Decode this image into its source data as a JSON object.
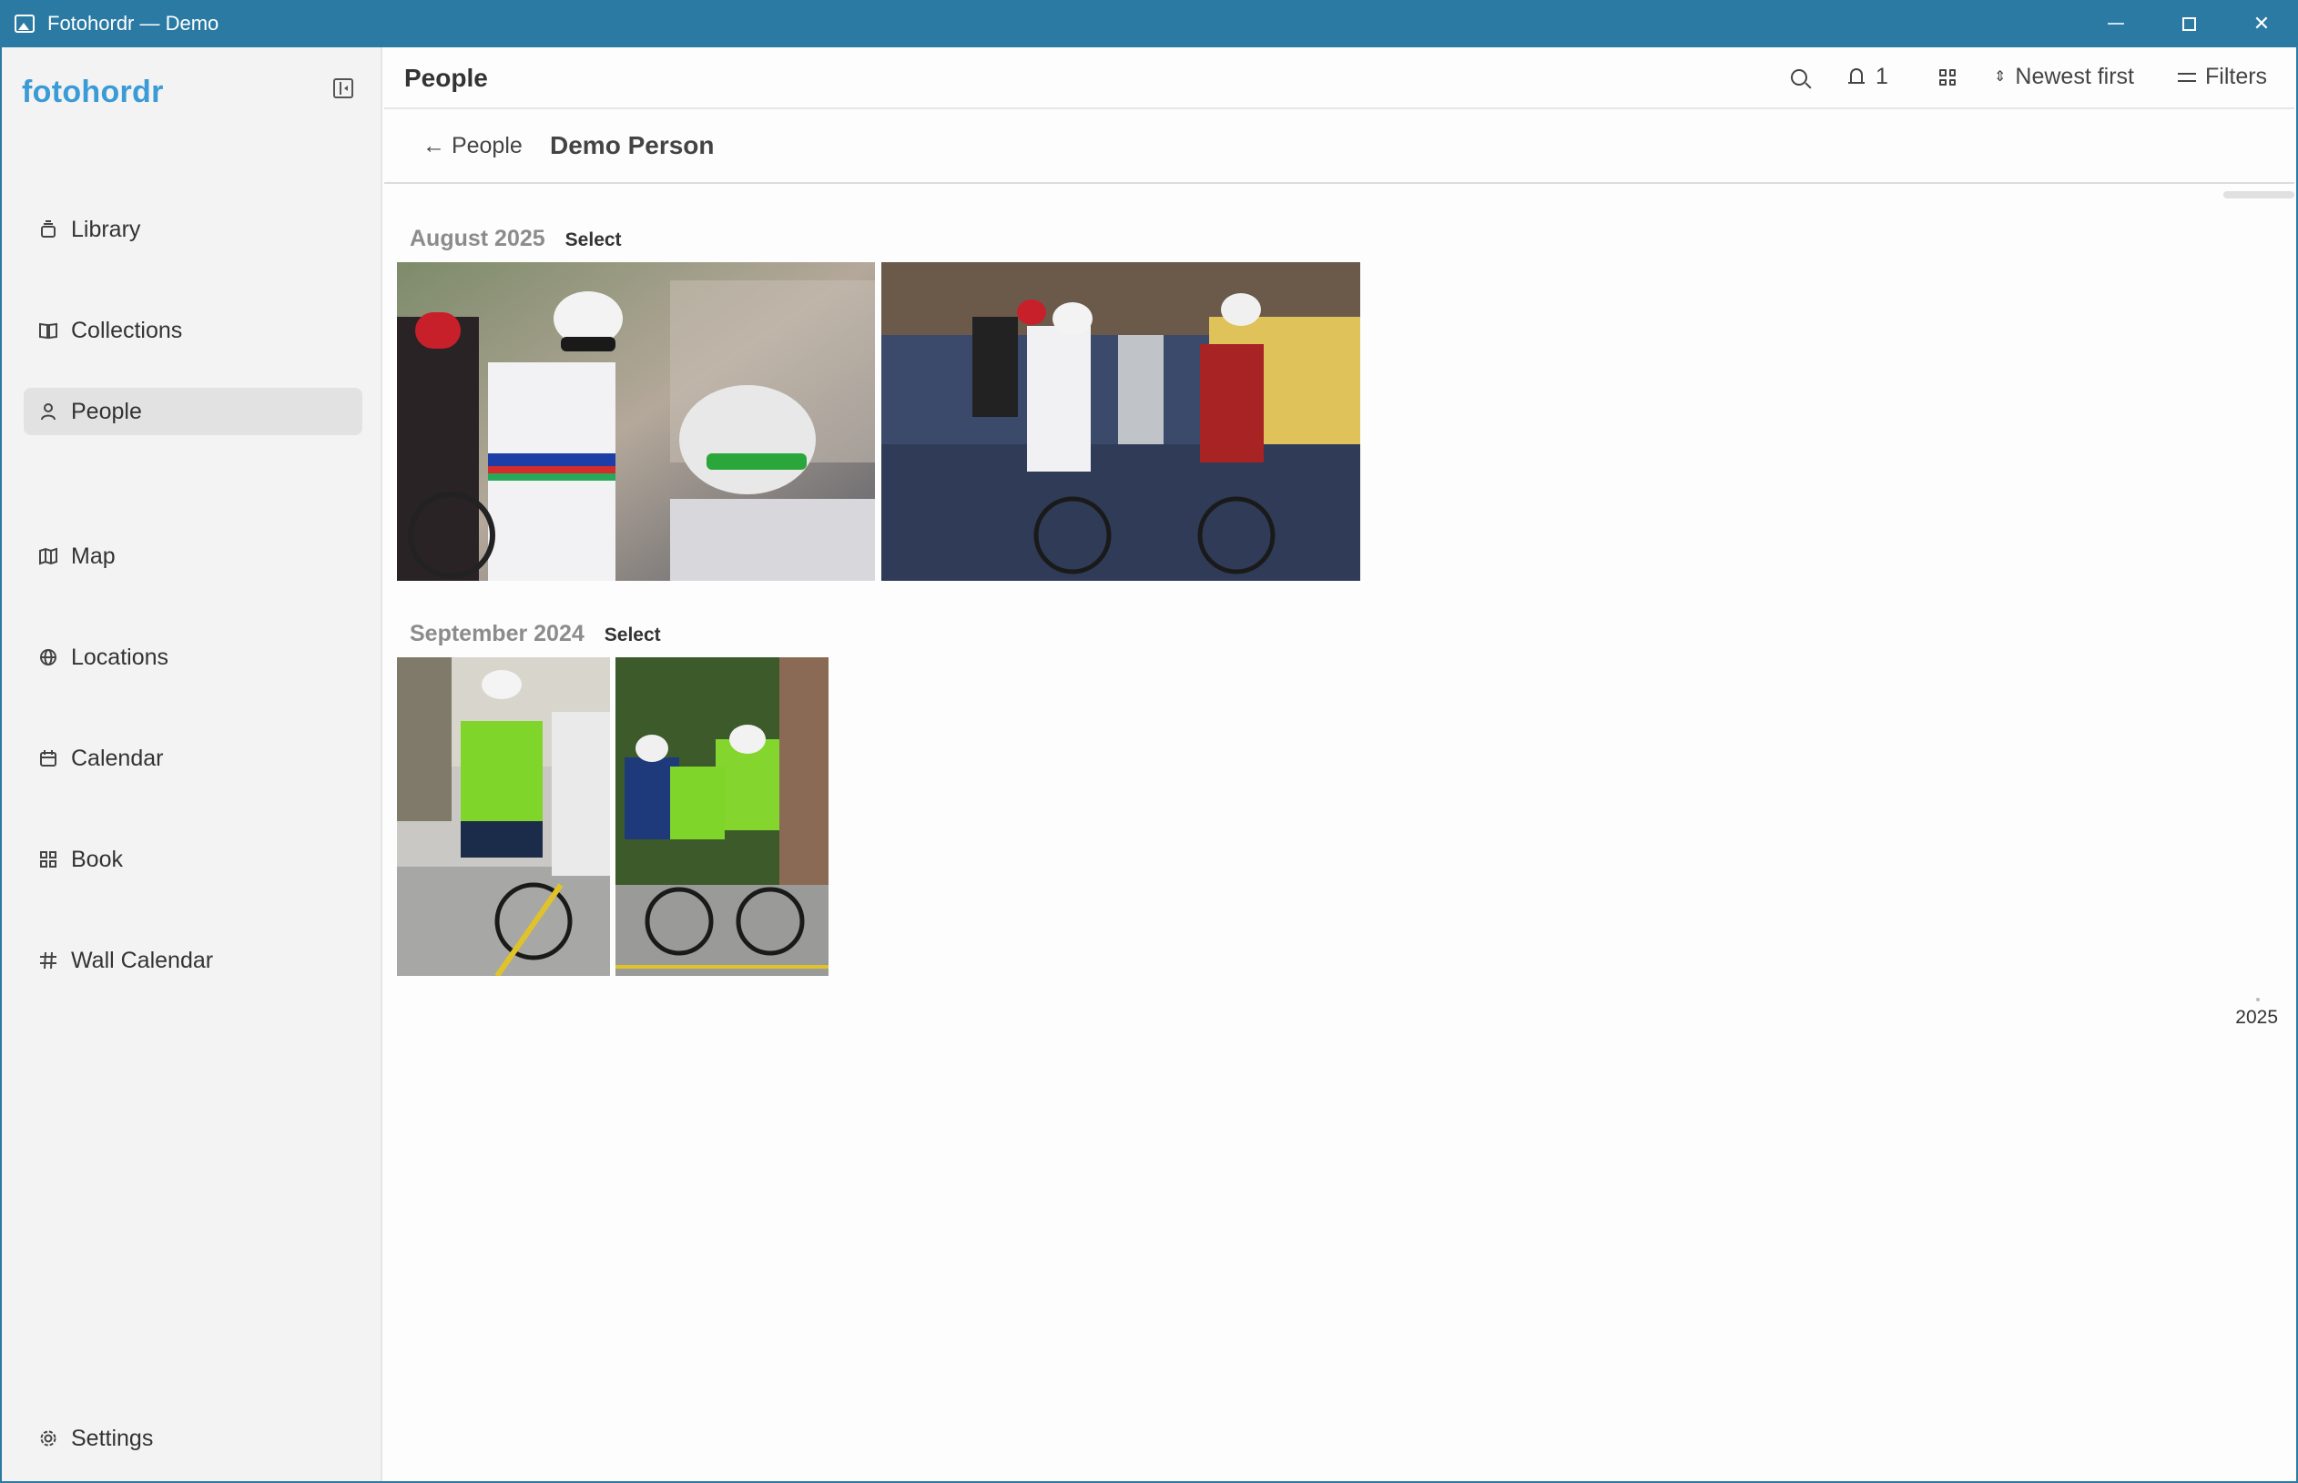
{
  "window": {
    "title": "Fotohordr — Demo",
    "controls": {
      "close": "✕"
    }
  },
  "sidebar": {
    "logo": "fotohordr",
    "items": [
      {
        "label": "Library",
        "icon": "library-icon"
      },
      {
        "label": "Collections",
        "icon": "book-open-icon"
      },
      {
        "label": "People",
        "icon": "person-icon",
        "active": true
      },
      {
        "label": "Map",
        "icon": "map-icon"
      },
      {
        "label": "Locations",
        "icon": "globe-icon"
      },
      {
        "label": "Calendar",
        "icon": "calendar-icon"
      },
      {
        "label": "Book",
        "icon": "grid-icon"
      },
      {
        "label": "Wall Calendar",
        "icon": "hash-icon"
      }
    ],
    "settings": {
      "label": "Settings",
      "icon": "gear-icon"
    }
  },
  "header": {
    "title": "People",
    "notifications_count": "1",
    "sort_label": "Newest first",
    "filters_label": "Filters"
  },
  "subheader": {
    "back_label": "← People",
    "person_name": "Demo Person"
  },
  "sections": [
    {
      "date": "August 2025",
      "select_label": "Select",
      "photo_count": 2
    },
    {
      "date": "September 2024",
      "select_label": "Select",
      "photo_count": 2
    }
  ],
  "timeline": {
    "year": "2025"
  },
  "colors": {
    "titlebar": "#2a7aa4",
    "logo": "#3a9bd6",
    "active_nav": "#e2e2e2"
  }
}
